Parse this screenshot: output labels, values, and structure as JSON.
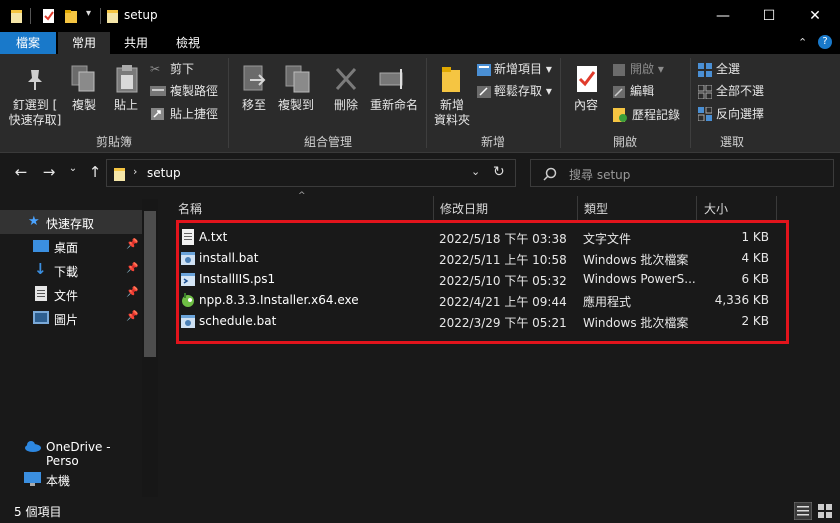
{
  "window": {
    "title": "setup",
    "minimize": "—",
    "maximize": "☐",
    "close": "✕"
  },
  "tabs": [
    "檔案",
    "常用",
    "共用",
    "檢視"
  ],
  "ribbon": {
    "clipboard": {
      "pin": "釘選到 [\n快速存取]",
      "copy": "複製",
      "paste": "貼上",
      "cut": "剪下",
      "copy_path": "複製路徑",
      "paste_shortcut": "貼上捷徑",
      "label": "剪貼簿"
    },
    "organize": {
      "move_to": "移至",
      "copy_to": "複製到",
      "delete": "刪除",
      "rename": "重新命名",
      "label": "組合管理"
    },
    "new": {
      "new_folder": "新增\n資料夾",
      "new_item": "新增項目 ▾",
      "easy_access": "輕鬆存取 ▾",
      "label": "新增"
    },
    "open": {
      "properties": "內容",
      "open": "開啟 ▾",
      "edit": "編輯",
      "history": "歷程記錄",
      "label": "開啟"
    },
    "select": {
      "select_all": "全選",
      "select_none": "全部不選",
      "invert": "反向選擇",
      "label": "選取"
    }
  },
  "address": {
    "path": "setup",
    "search_placeholder": "搜尋 setup"
  },
  "nav": {
    "quick_access": "快速存取",
    "items": [
      {
        "label": "桌面",
        "icon": "desktop-icon"
      },
      {
        "label": "下載",
        "icon": "download-icon"
      },
      {
        "label": "文件",
        "icon": "documents-icon"
      },
      {
        "label": "圖片",
        "icon": "pictures-icon"
      }
    ],
    "onedrive": "OneDrive - Perso",
    "this_pc": "本機"
  },
  "columns": {
    "name": "名稱",
    "date": "修改日期",
    "type": "類型",
    "size": "大小"
  },
  "files": [
    {
      "name": "A.txt",
      "date": "2022/5/18 下午 03:38",
      "type": "文字文件",
      "size": "1 KB",
      "icon": "text-file-icon"
    },
    {
      "name": "install.bat",
      "date": "2022/5/11 上午 10:58",
      "type": "Windows 批次檔案",
      "size": "4 KB",
      "icon": "batch-file-icon"
    },
    {
      "name": "InstallIIS.ps1",
      "date": "2022/5/10 下午 05:32",
      "type": "Windows PowerS...",
      "size": "6 KB",
      "icon": "powershell-file-icon"
    },
    {
      "name": "npp.8.3.3.Installer.x64.exe",
      "date": "2022/4/21 上午 09:44",
      "type": "應用程式",
      "size": "4,336 KB",
      "icon": "installer-exe-icon"
    },
    {
      "name": "schedule.bat",
      "date": "2022/3/29 下午 05:21",
      "type": "Windows 批次檔案",
      "size": "2 KB",
      "icon": "batch-file-icon"
    }
  ],
  "status": {
    "item_count": "5 個項目"
  },
  "colors": {
    "file_tab": "#1979ca",
    "highlight_box": "#e2141c",
    "folder": "#f5c542"
  }
}
